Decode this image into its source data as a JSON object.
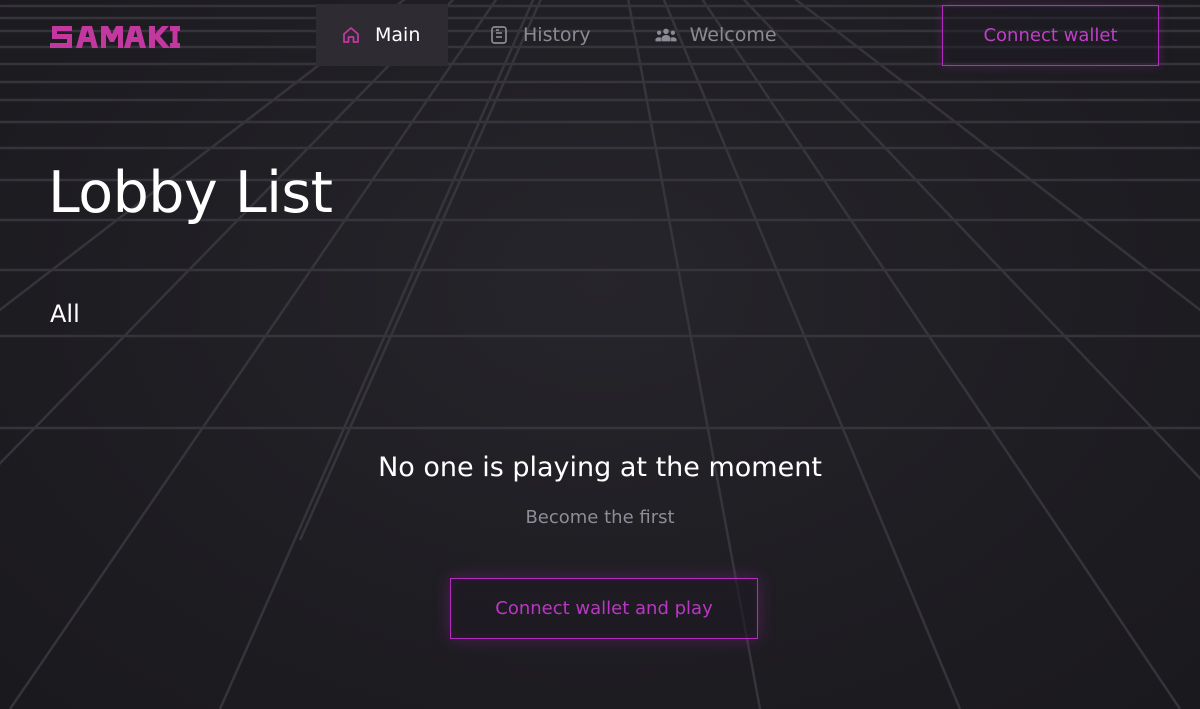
{
  "brand": {
    "logo_text": "SAMAKI",
    "accent_color": "#c2389f"
  },
  "nav": {
    "items": [
      {
        "label": "Main",
        "icon": "home-icon",
        "active": true
      },
      {
        "label": "History",
        "icon": "document-icon",
        "active": false
      },
      {
        "label": "Welcome",
        "icon": "users-icon",
        "active": false
      }
    ]
  },
  "header": {
    "connect_label": "Connect wallet"
  },
  "main": {
    "title": "Lobby List",
    "filter_label": "All",
    "empty": {
      "title": "No one is playing at the moment",
      "subtitle": "Become the first",
      "cta_label": "Connect wallet and play"
    }
  },
  "colors": {
    "button_border": "#b52bc0",
    "button_text": "#c03fc8",
    "muted_text": "#8f8c98",
    "background": "#1d1c20"
  }
}
